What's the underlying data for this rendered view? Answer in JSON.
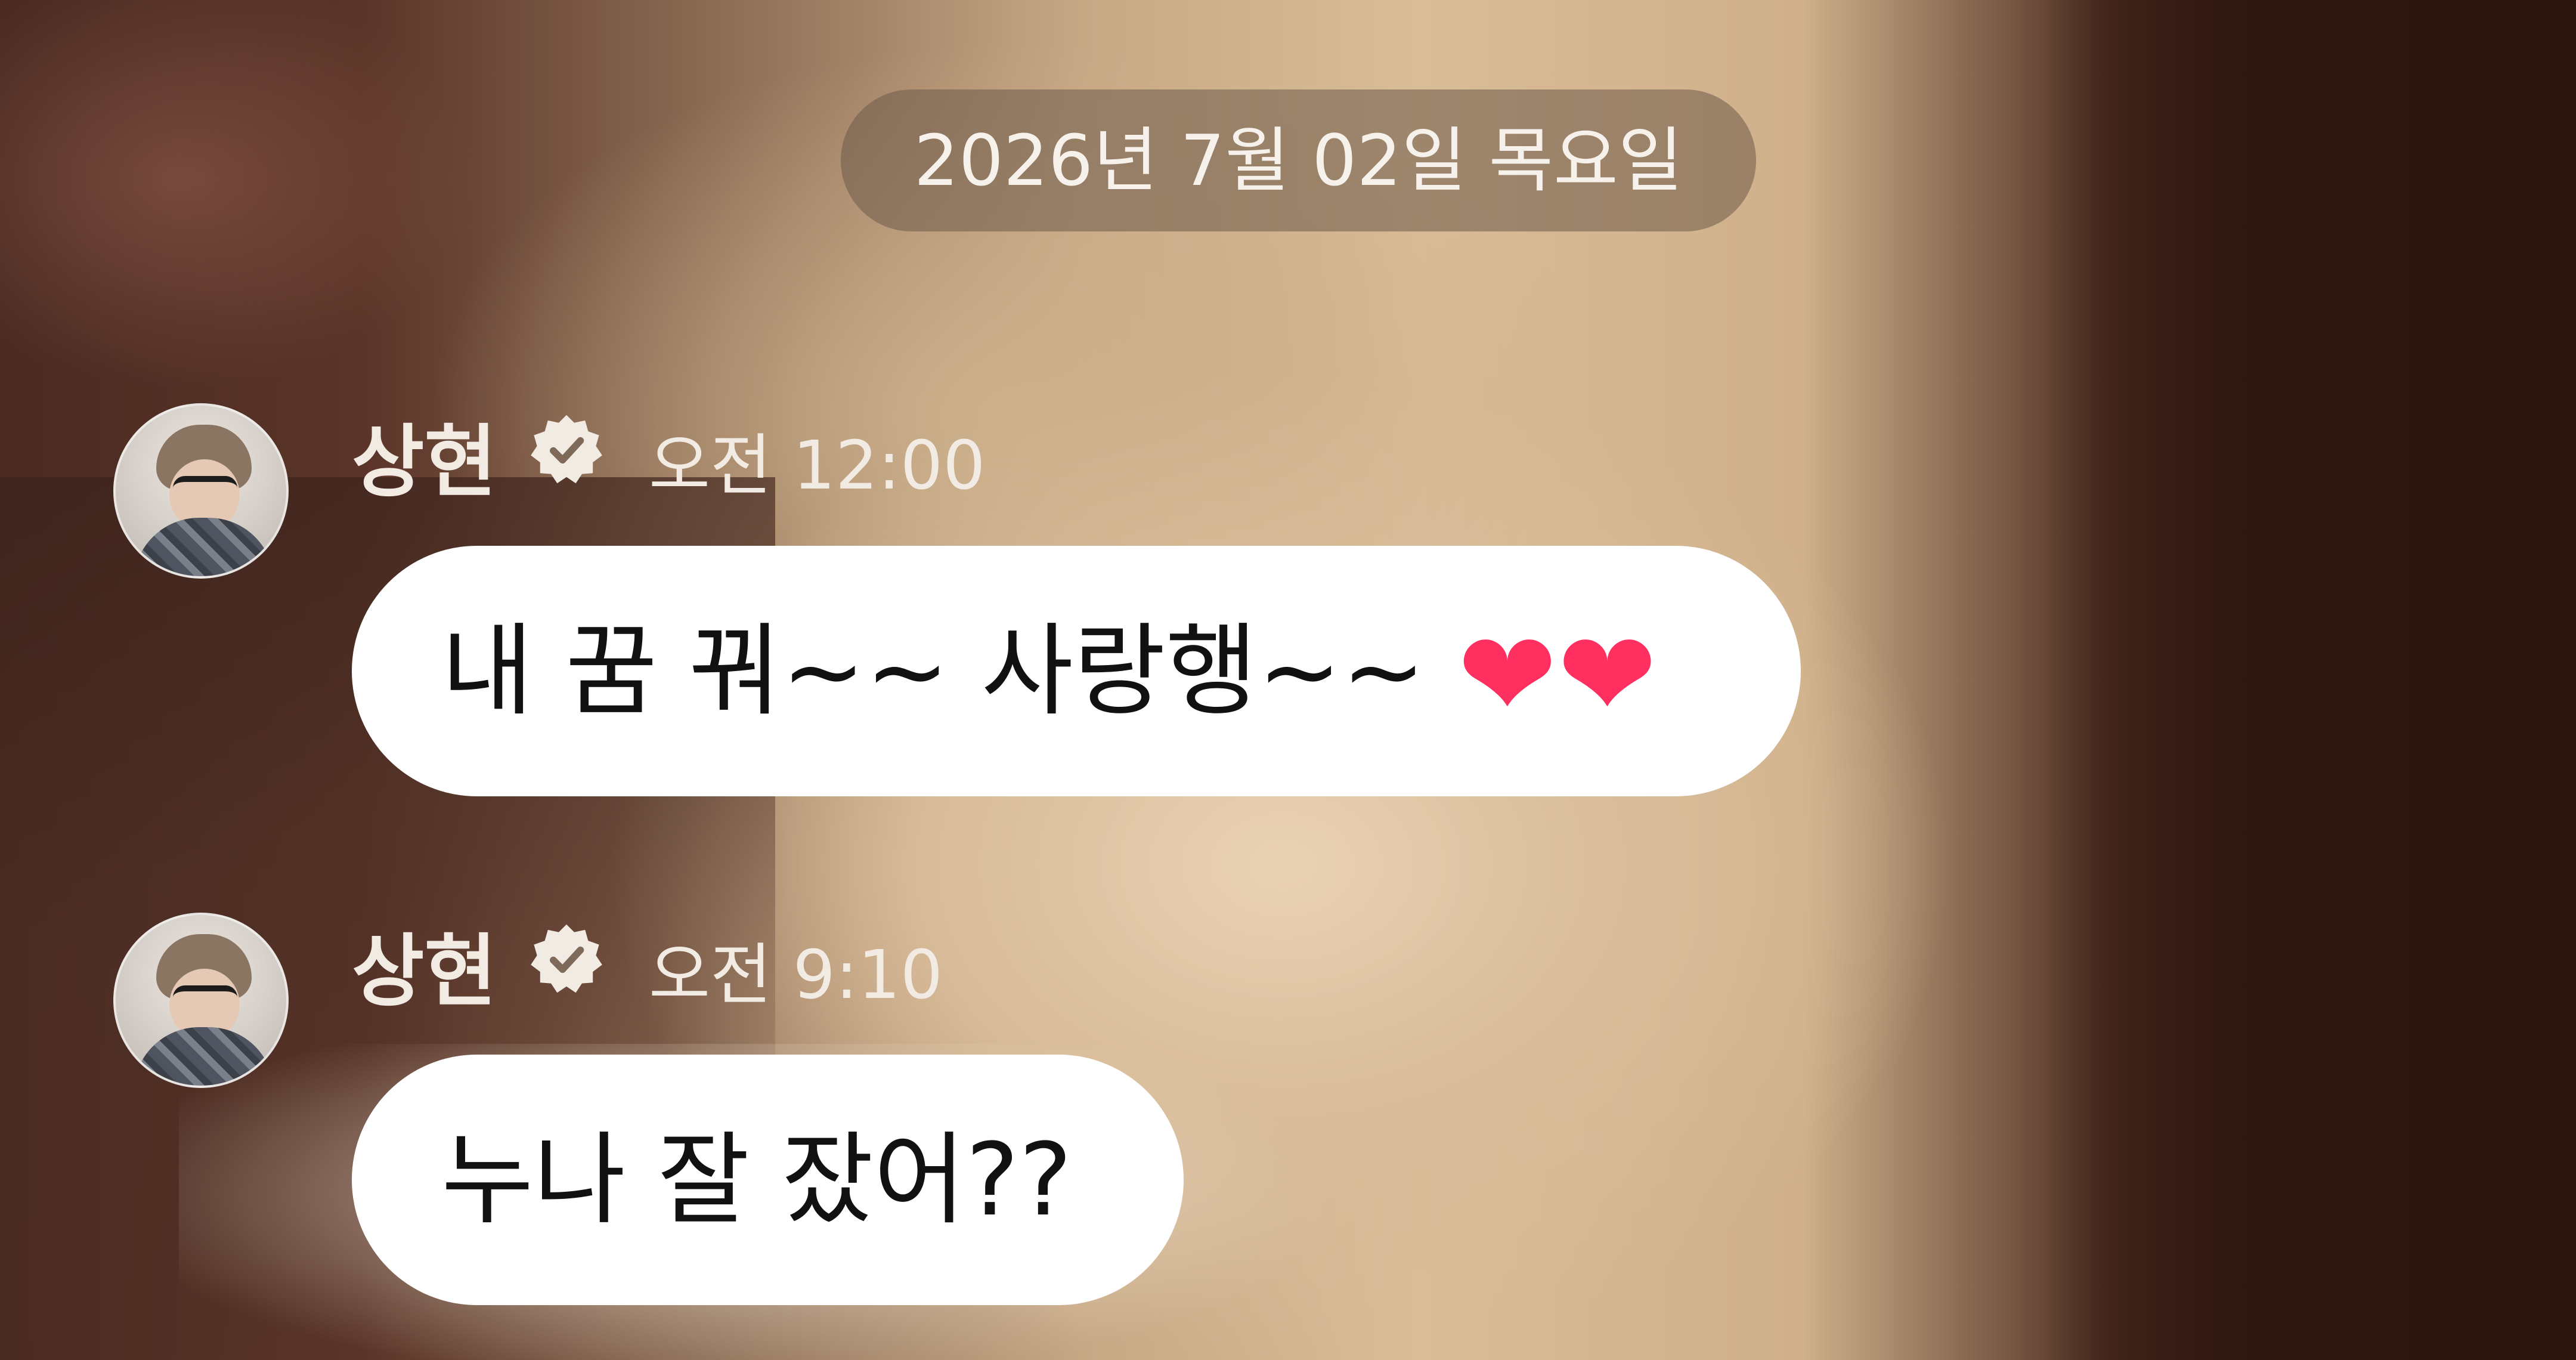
{
  "date_separator": "2026년 7월 02일 목요일",
  "messages": [
    {
      "sender": "상현",
      "time": "오전 12:00",
      "text": "내 꿈 꿔~~ 사랑행~~",
      "emoji": "❤❤"
    },
    {
      "sender": "상현",
      "time": "오전 9:10",
      "text": "누나 잘 잤어??"
    }
  ],
  "colors": {
    "bubble": "#ffffff",
    "bubble_text": "#111111",
    "meta_text": "#f1ebe4",
    "heart": "#ff2f5f"
  },
  "icons": {
    "verified": "verified-badge-icon",
    "heart": "heart-icon"
  }
}
